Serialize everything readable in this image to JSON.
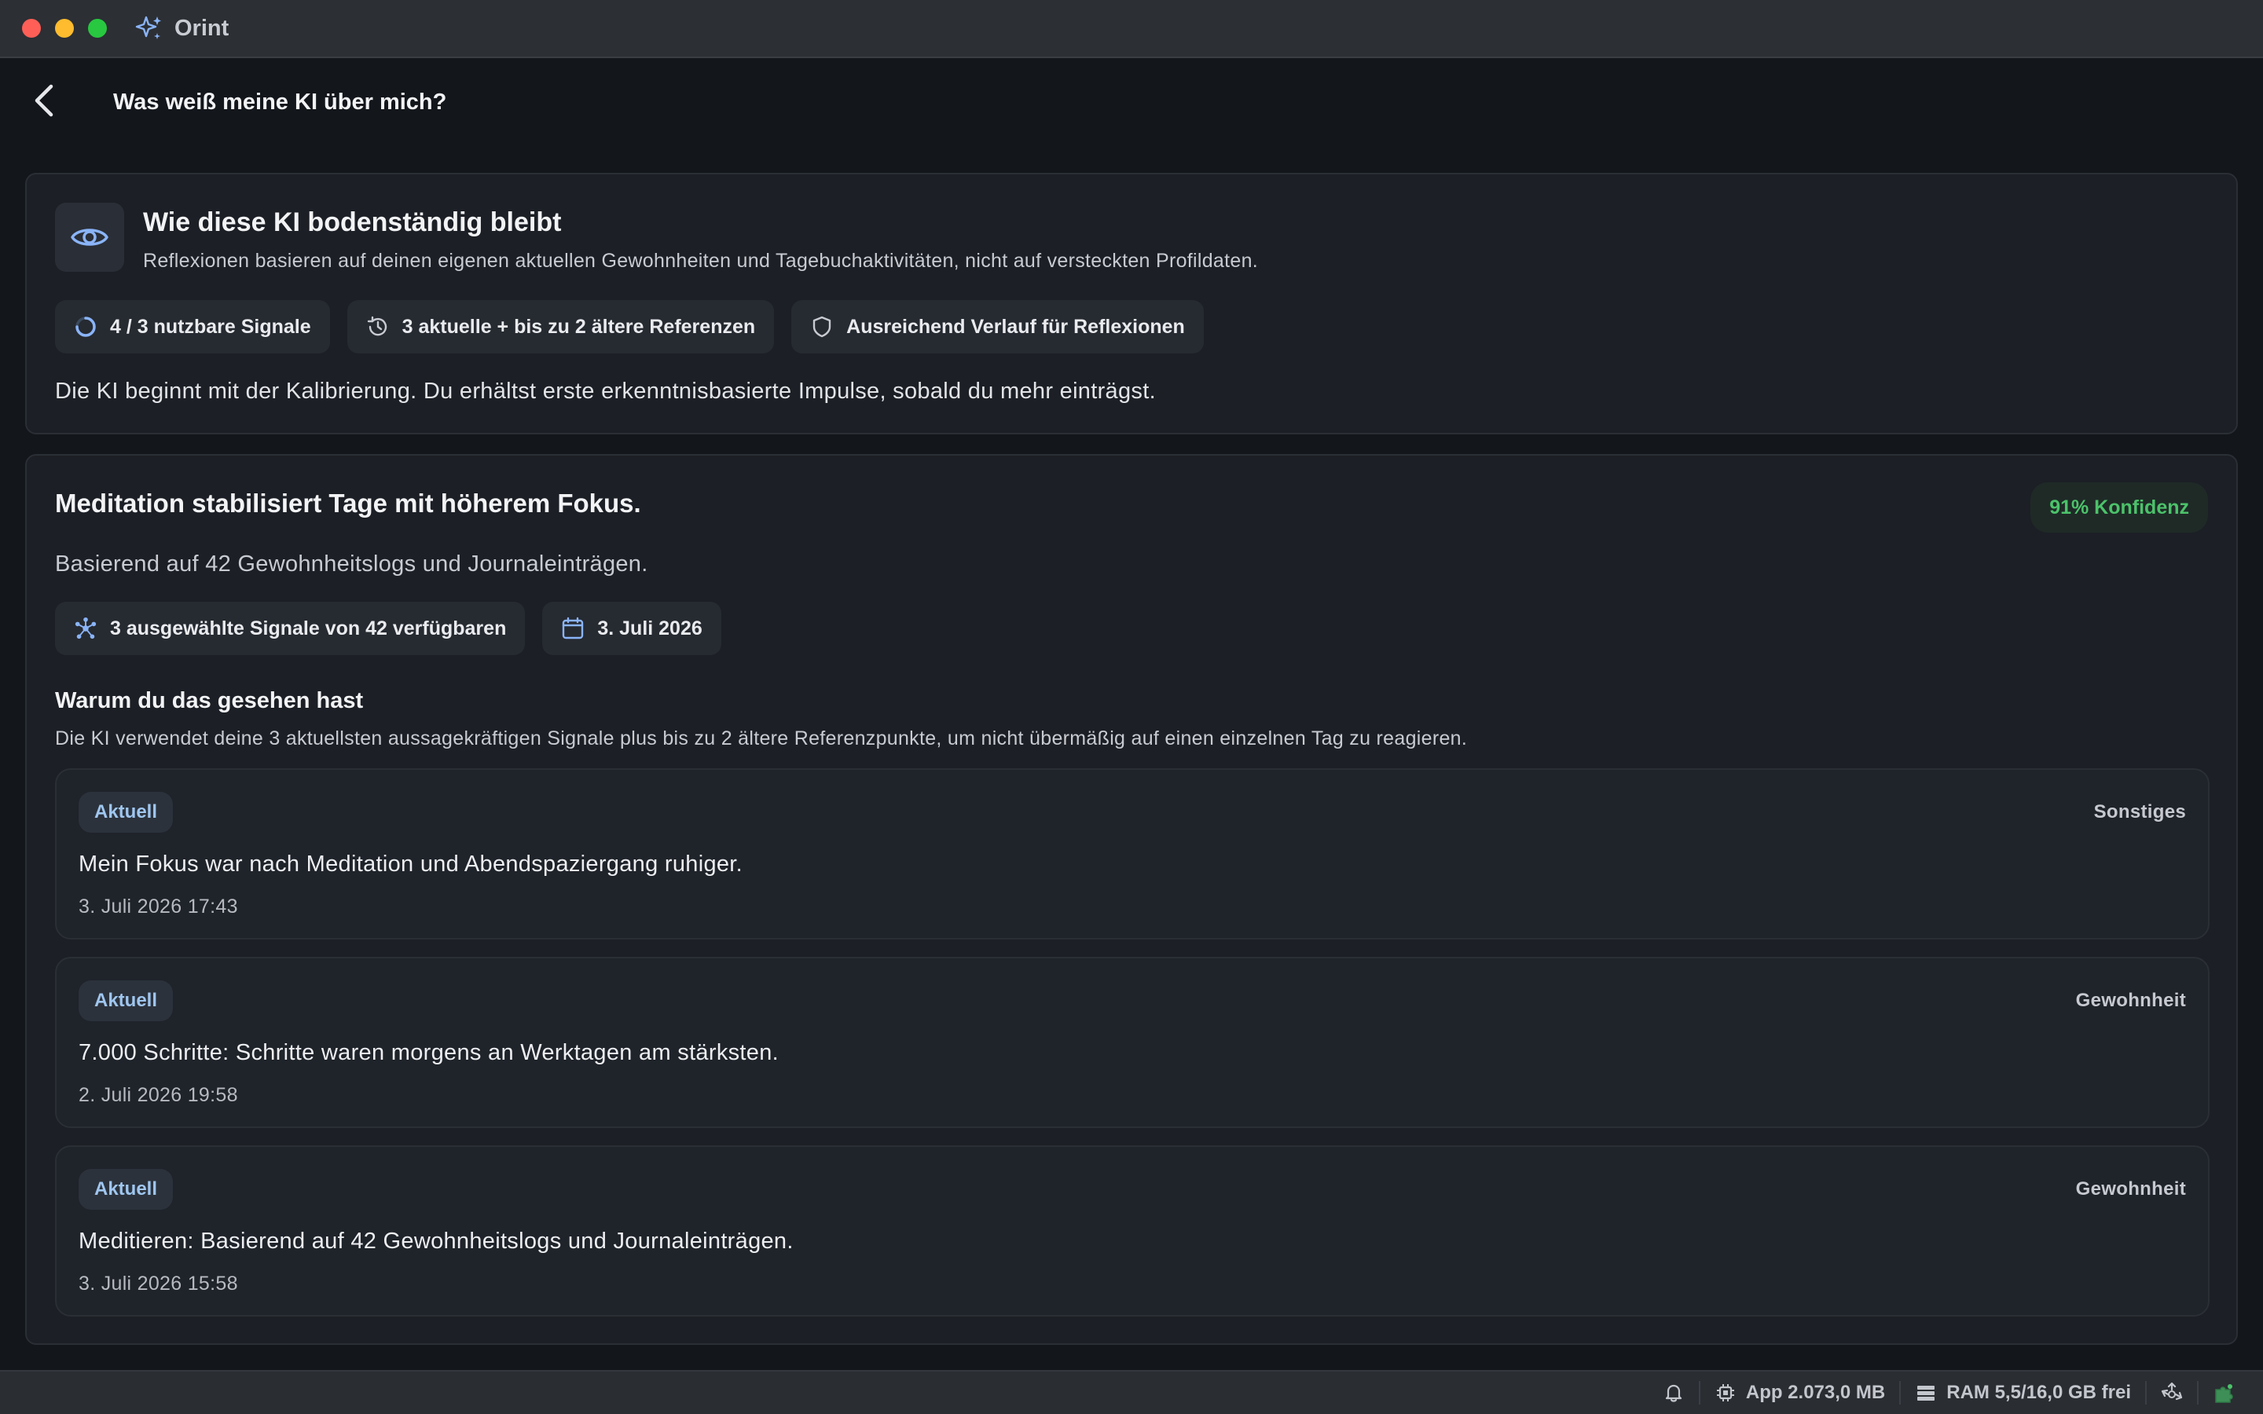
{
  "window": {
    "app_title": "Orint",
    "app_icon": "sparkles-icon"
  },
  "header": {
    "title": "Was weiß meine KI über mich?",
    "back_icon": "chevron-left-icon"
  },
  "grounding_card": {
    "title": "Wie diese KI bodenständig bleibt",
    "subtitle": "Reflexionen basieren auf deinen eigenen aktuellen Gewohnheiten und Tagebuchaktivitäten, nicht auf versteckten Profildaten.",
    "icon": "eye-icon",
    "chips": [
      {
        "icon": "progress-ring-icon",
        "label": "4 / 3 nutzbare Signale"
      },
      {
        "icon": "history-clock-icon",
        "label": "3 aktuelle + bis zu 2 ältere Referenzen"
      },
      {
        "icon": "shield-icon",
        "label": "Ausreichend Verlauf für Reflexionen"
      }
    ],
    "note": "Die KI beginnt mit der Kalibrierung. Du erhältst erste erkenntnisbasierte Impulse, sobald du mehr einträgst."
  },
  "insight_card": {
    "title": "Meditation stabilisiert Tage mit höherem Fokus.",
    "confidence": "91% Konfidenz",
    "subtitle": "Basierend auf 42 Gewohnheitslogs und Journaleinträgen.",
    "chips": [
      {
        "icon": "network-icon",
        "label": "3 ausgewählte Signale von 42 verfügbaren"
      },
      {
        "icon": "calendar-icon",
        "label": "3. Juli 2026"
      }
    ],
    "why_title": "Warum du das gesehen hast",
    "why_desc": "Die KI verwendet deine 3 aktuellsten aussagekräftigen Signale plus bis zu 2 ältere Referenzpunkte, um nicht übermäßig auf einen einzelnen Tag zu reagieren.",
    "signals": [
      {
        "tag": "Aktuell",
        "category": "Sonstiges",
        "text": "Mein Fokus war nach Meditation und Abendspaziergang ruhiger.",
        "time": "3. Juli 2026 17:43"
      },
      {
        "tag": "Aktuell",
        "category": "Gewohnheit",
        "text": "7.000 Schritte: Schritte waren morgens an Werktagen am stärksten.",
        "time": "2. Juli 2026 19:58"
      },
      {
        "tag": "Aktuell",
        "category": "Gewohnheit",
        "text": "Meditieren: Basierend auf 42 Gewohnheitslogs und Journaleinträgen.",
        "time": "3. Juli 2026 15:58"
      }
    ]
  },
  "statusbar": {
    "app_memory": "App 2.073,0 MB",
    "ram": "RAM 5,5/16,0 GB frei"
  },
  "colors": {
    "accent": "#8ab4f8",
    "confidence_green": "#4cc26a",
    "background": "#13161b"
  }
}
